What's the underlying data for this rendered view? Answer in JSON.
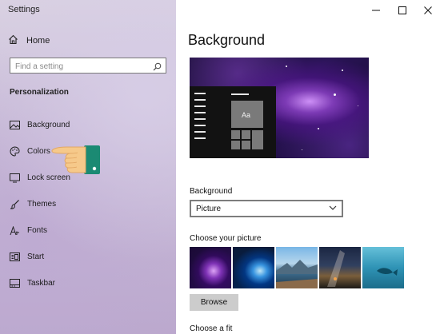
{
  "window": {
    "title": "Settings",
    "controls": {
      "minimize": "—",
      "maximize": "☐",
      "close": "✕"
    }
  },
  "sidebar": {
    "home_label": "Home",
    "search_placeholder": "Find a setting",
    "section_title": "Personalization",
    "items": [
      {
        "label": "Background",
        "icon": "picture-icon",
        "selected": true
      },
      {
        "label": "Colors",
        "icon": "palette-icon"
      },
      {
        "label": "Lock screen",
        "icon": "monitor-icon"
      },
      {
        "label": "Themes",
        "icon": "brush-icon"
      },
      {
        "label": "Fonts",
        "icon": "font-icon"
      },
      {
        "label": "Start",
        "icon": "start-icon"
      },
      {
        "label": "Taskbar",
        "icon": "taskbar-icon"
      }
    ]
  },
  "main": {
    "title": "Background",
    "preview": {
      "tile_label": "Aa"
    },
    "background_label": "Background",
    "background_select": {
      "value": "Picture"
    },
    "choose_picture_label": "Choose your picture",
    "thumbnails": [
      "galaxy",
      "windows-light",
      "beach",
      "night-sky",
      "underwater"
    ],
    "browse_label": "Browse",
    "choose_fit_label": "Choose a fit"
  },
  "colors": {
    "sidebar_bg": "#c9bdd8",
    "main_bg": "#ffffff",
    "button_bg": "#cccccc",
    "hand_skin": "#f6c98a",
    "cuff": "#1b8a73"
  }
}
